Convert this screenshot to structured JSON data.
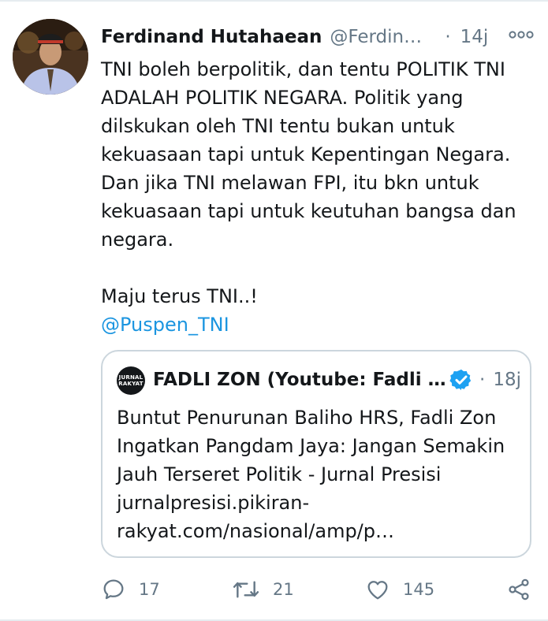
{
  "tweet": {
    "author_name": "Ferdinand Hutahaean",
    "author_handle": "@Ferdinand_Hutahaean",
    "separator": "·",
    "time": "14j",
    "more_icon": "more-horizontal-icon",
    "paragraphs": [
      "TNI boleh berpolitik, dan tentu POLITIK TNI ADALAH POLITIK NEGARA. Politik yang dilskukan oleh TNI tentu bukan untuk kekuasaan tapi untuk Kepentingan Negara. Dan jika TNI melawan FPI, itu bkn untuk kekuasaan tapi untuk keutuhan bangsa dan negara.",
      "Maju terus TNI..!"
    ],
    "mention": "@Puspen_TNI"
  },
  "quote": {
    "logo_text_line1": "JURNAL",
    "logo_text_line2": "RAKYAT",
    "name": "FADLI ZON (Youtube: Fadli Zon Official)",
    "verified_icon": "verified-badge-icon",
    "separator": "·",
    "time": "18j",
    "text": "Buntut Penurunan Baliho HRS, Fadli Zon Ingatkan Pangdam Jaya: Jangan Semakin Jauh Terseret Politik - Jurnal Presisi jurnalpresisi.pikiran-rakyat.com/nasional/amp/p…"
  },
  "actions": {
    "reply_count": "17",
    "retweet_count": "21",
    "like_count": "145",
    "icons": [
      "reply-icon",
      "retweet-icon",
      "like-icon",
      "share-icon"
    ]
  },
  "colors": {
    "text": "#14171a",
    "secondary": "#657786",
    "link": "#1b95e0",
    "border": "#ccd6dd",
    "verified": "#1da1f2"
  }
}
